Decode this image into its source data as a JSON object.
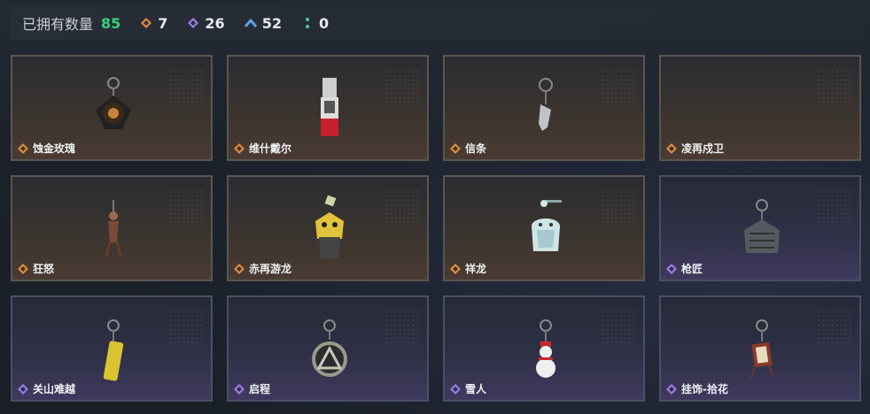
{
  "header": {
    "title": "已拥有数量",
    "total": "85",
    "stats": [
      {
        "icon": "orange-diamond-icon",
        "color": "#e08a3a",
        "value": "7"
      },
      {
        "icon": "purple-diamond-icon",
        "color": "#9b7be8",
        "value": "26"
      },
      {
        "icon": "blue-chevron-icon",
        "color": "#5aa3e8",
        "value": "52"
      },
      {
        "icon": "green-dots-icon",
        "color": "#3ccf9a",
        "value": "0"
      }
    ]
  },
  "colors": {
    "orange_rarity": "#e08a3a",
    "purple_rarity": "#9b7be8"
  },
  "items": [
    {
      "name": "蚀金玫瑰",
      "rarity": "orange"
    },
    {
      "name": "维什戴尔",
      "rarity": "orange"
    },
    {
      "name": "信条",
      "rarity": "orange"
    },
    {
      "name": "凌再戍卫",
      "rarity": "orange"
    },
    {
      "name": "狂怒",
      "rarity": "orange"
    },
    {
      "name": "赤再游龙",
      "rarity": "orange"
    },
    {
      "name": "祥龙",
      "rarity": "orange"
    },
    {
      "name": "枪匠",
      "rarity": "purple"
    },
    {
      "name": "关山难越",
      "rarity": "purple"
    },
    {
      "name": "启程",
      "rarity": "purple"
    },
    {
      "name": "雪人",
      "rarity": "purple"
    },
    {
      "name": "挂饰-拾花",
      "rarity": "purple"
    }
  ]
}
